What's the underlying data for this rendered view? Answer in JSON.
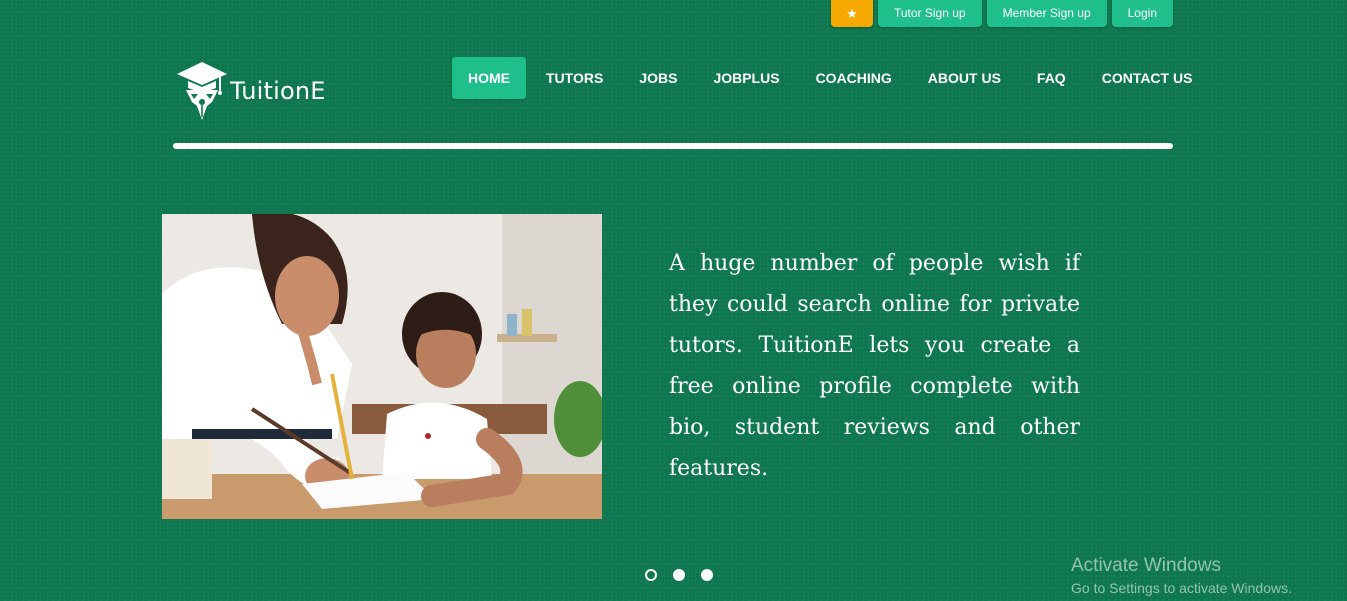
{
  "topbar": {
    "star_icon": "★",
    "tutor_signup": "Tutor Sign up",
    "member_signup": "Member Sign up",
    "login": "Login"
  },
  "logo": {
    "text": "TuitionE"
  },
  "nav": {
    "items": [
      {
        "label": "HOME",
        "active": true
      },
      {
        "label": "TUTORS"
      },
      {
        "label": "JOBS"
      },
      {
        "label": "JOBPLUS"
      },
      {
        "label": "COACHING"
      },
      {
        "label": "ABOUT US"
      },
      {
        "label": "FAQ"
      },
      {
        "label": "CONTACT US"
      }
    ]
  },
  "hero": {
    "text": "A huge number of people wish if they could search online for private tutors. TuitionE lets you create a free online profile complete with bio, student reviews and other features."
  },
  "carousel": {
    "slides": 3,
    "active_index": 0
  },
  "watermark": {
    "title": "Activate Windows",
    "subtitle": "Go to Settings to activate Windows."
  },
  "colors": {
    "background": "#0f7a52",
    "accent": "#1fbf8c",
    "star_button": "#f5a800"
  }
}
